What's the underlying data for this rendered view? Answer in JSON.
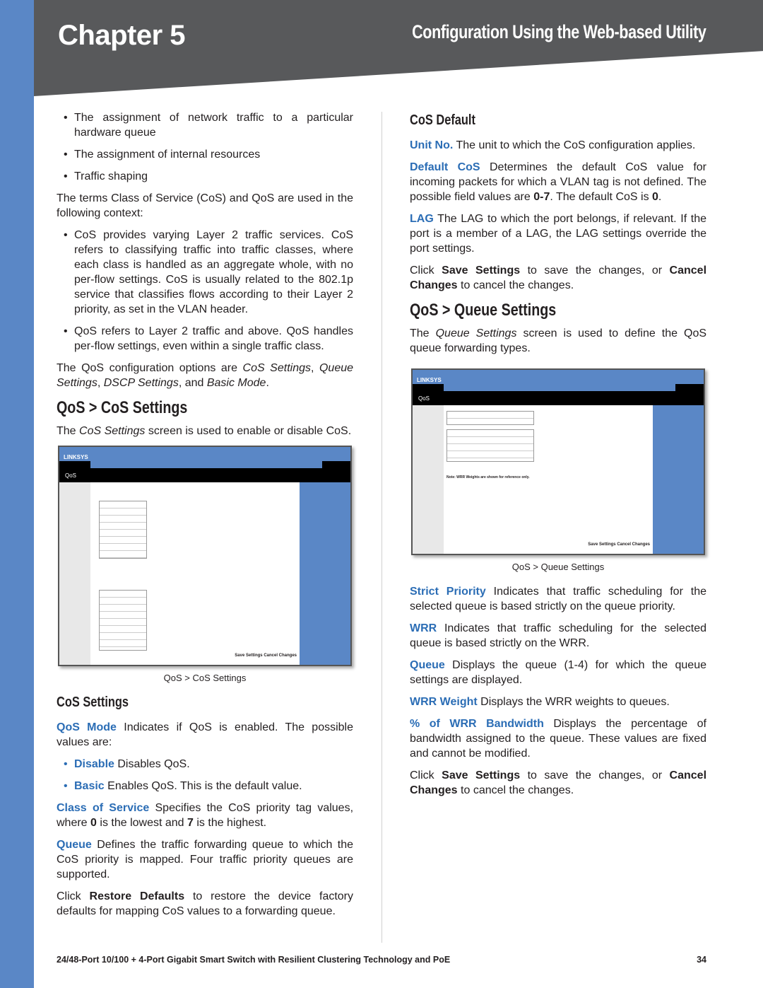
{
  "header": {
    "chapter": "Chapter 5",
    "title": "Configuration Using the Web-based Utility"
  },
  "left": {
    "bullets1": [
      "The assignment of network traffic to a particular hardware queue",
      "The assignment of internal resources",
      "Traffic shaping"
    ],
    "p1": "The terms Class of Service (CoS) and QoS are used in the following context:",
    "bullets2": [
      "CoS provides varying Layer 2 traffic services. CoS refers to classifying traffic into traffic classes, where each class is handled as an aggregate whole, with no per-flow settings. CoS is usually related to the 802.1p service that classifies flows according to their Layer 2 priority, as set in the VLAN header.",
      "QoS refers to Layer 2 traffic and above. QoS handles per-flow settings, even within a single traffic class."
    ],
    "p2": {
      "a": "The QoS configuration options are ",
      "b": "CoS Settings",
      "c": ", ",
      "d": "Queue Settings",
      "e": ", ",
      "f": "DSCP Settings",
      "g": ", and ",
      "h": "Basic Mode",
      "i": "."
    },
    "h_cos": "QoS > CoS Settings",
    "p3": {
      "a": "The ",
      "b": "CoS Settings",
      "c": " screen is used to enable or disable CoS."
    },
    "shot": {
      "logo": "LINKSYS",
      "section": "QoS",
      "buttons": "Save Settings  Cancel Changes"
    },
    "caption": "QoS > CoS Settings",
    "h_settings": "CoS Settings",
    "qos_mode": {
      "term": "QoS Mode",
      "text": " Indicates if QoS is enabled. The possible values are:"
    },
    "modes": [
      {
        "term": "Disable",
        "text": " Disables QoS."
      },
      {
        "term": "Basic",
        "text": " Enables QoS. This is the default value."
      }
    ],
    "cos": {
      "term": "Class of Service",
      "a": " Specifies the CoS priority tag values, where ",
      "b": "0",
      "c": " is the lowest and ",
      "d": "7",
      "e": " is the highest."
    },
    "queue": {
      "term": "Queue",
      "text": " Defines the traffic forwarding queue to which the CoS priority is mapped. Four traffic priority queues are supported."
    },
    "restore": {
      "a": "Click ",
      "b": "Restore Defaults",
      "c": " to restore the device factory defaults for mapping CoS values to a forwarding queue."
    }
  },
  "right": {
    "h_default": "CoS Default",
    "unit": {
      "term": "Unit No.",
      "text": " The unit to which the CoS configuration applies."
    },
    "default_cos": {
      "term": "Default CoS",
      "a": " Determines the default CoS value for incoming packets for which a VLAN tag is not defined. The possible field values are ",
      "b": "0-7",
      "c": ". The default CoS is ",
      "d": "0",
      "e": "."
    },
    "lag": {
      "term": "LAG",
      "text": " The LAG to which the port belongs, if relevant. If the port is a member of a LAG, the LAG settings override the port settings."
    },
    "save1": {
      "a": "Click ",
      "b": "Save Settings",
      "c": " to save the changes, or ",
      "d": "Cancel Changes",
      "e": " to cancel the changes."
    },
    "h_queue": "QoS > Queue Settings",
    "p_queue": {
      "a": "The ",
      "b": "Queue Settings",
      "c": " screen is used to define the QoS queue forwarding types."
    },
    "shot": {
      "logo": "LINKSYS",
      "section": "QoS",
      "note": "Note: WRR Weights are shown for reference only.",
      "buttons": "Save Settings  Cancel Changes"
    },
    "caption": "QoS > Queue Settings",
    "strict": {
      "term": "Strict Priority",
      "text": " Indicates that traffic scheduling for the selected queue is based strictly on the queue priority."
    },
    "wrr": {
      "term": "WRR",
      "text": " Indicates that traffic scheduling for the selected queue is based strictly on the WRR."
    },
    "queue": {
      "term": "Queue",
      "text": " Displays the queue (1-4) for which the queue settings are displayed."
    },
    "wrr_weight": {
      "term": "WRR Weight",
      "text": " Displays the WRR weights to queues."
    },
    "bandwidth": {
      "term": "% of WRR Bandwidth",
      "text": " Displays the percentage of bandwidth assigned to the queue. These values are fixed and cannot be modified."
    },
    "save2": {
      "a": "Click ",
      "b": "Save Settings",
      "c": " to save the changes, or ",
      "d": "Cancel Changes",
      "e": " to cancel the changes."
    }
  },
  "footer": {
    "text": "24/48-Port 10/100 + 4-Port Gigabit Smart Switch with Resilient Clustering Technology and PoE",
    "page": "34"
  },
  "colors": {
    "accent": "#2b6db5",
    "header": "#58595b",
    "strip": "#5a87c6"
  }
}
